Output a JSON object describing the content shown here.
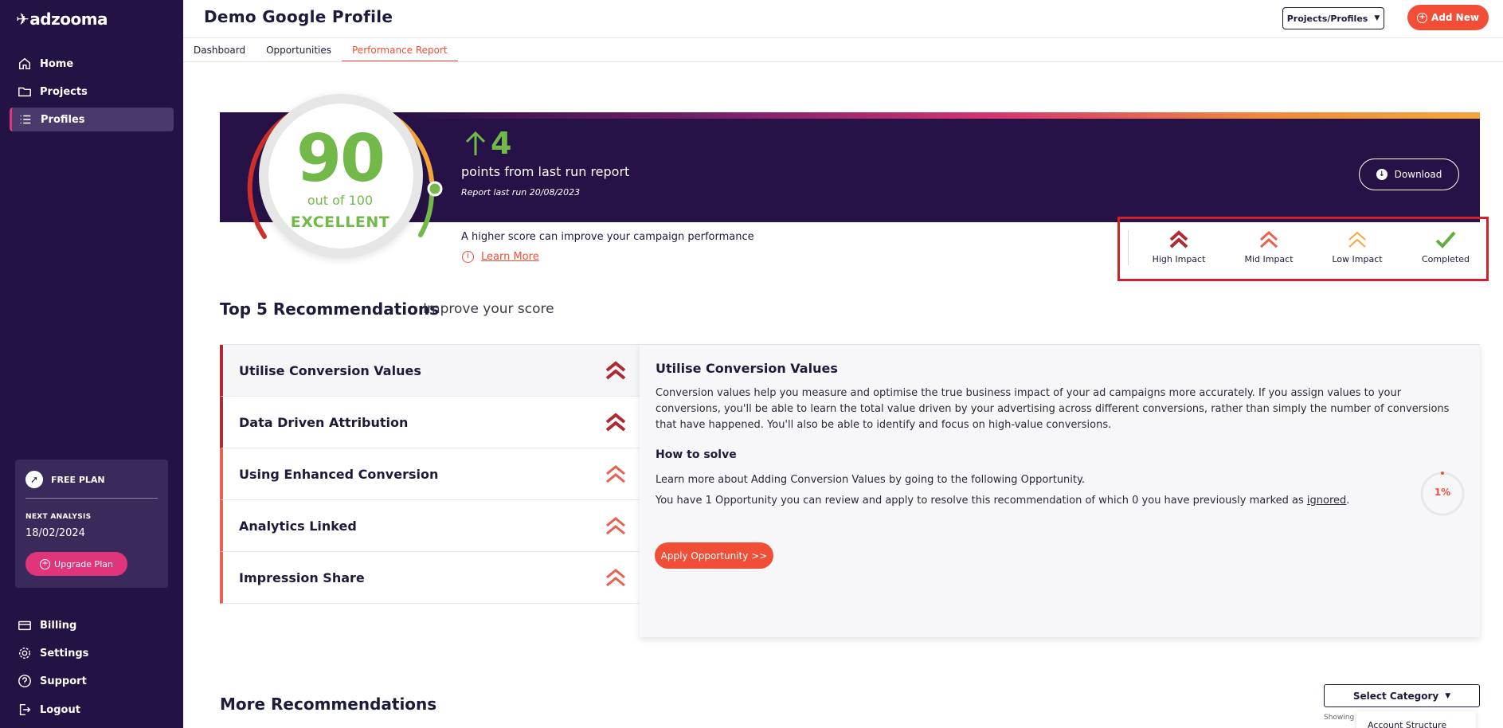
{
  "app": {
    "logo": "adzooma"
  },
  "sidebar": {
    "items": [
      {
        "label": "Home",
        "icon": "home-icon"
      },
      {
        "label": "Projects",
        "icon": "folder-icon"
      },
      {
        "label": "Profiles",
        "icon": "list-icon",
        "active": true
      }
    ],
    "plan": {
      "name": "FREE PLAN",
      "next_label": "NEXT ANALYSIS",
      "next_date": "18/02/2024",
      "upgrade_label": "Upgrade Plan"
    },
    "bottom_items": [
      {
        "label": "Billing",
        "icon": "card-icon"
      },
      {
        "label": "Settings",
        "icon": "gear-icon"
      },
      {
        "label": "Support",
        "icon": "help-icon"
      },
      {
        "label": "Logout",
        "icon": "logout-icon"
      }
    ]
  },
  "header": {
    "title": "Demo Google Profile",
    "projects_button": "Projects/Profiles",
    "add_new_button": "Add New"
  },
  "tabs": [
    {
      "label": "Dashboard"
    },
    {
      "label": "Opportunities"
    },
    {
      "label": "Performance Report",
      "active": true
    }
  ],
  "score": {
    "value": "90",
    "out_of": "out of 100",
    "rating": "EXCELLENT",
    "delta": "4",
    "delta_text": "points from last run report",
    "last_run": "Report last run 20/08/2023",
    "download_label": "Download",
    "hint": "A higher score can improve your campaign performance",
    "learn_more": "Learn More",
    "fraction": 0.9
  },
  "legend": {
    "items": [
      {
        "label": "High Impact",
        "color": "#b02a33"
      },
      {
        "label": "Mid Impact",
        "color": "#e8614f"
      },
      {
        "label": "Low Impact",
        "color": "#f5a63b"
      },
      {
        "label": "Completed",
        "color": "#5fae3e"
      }
    ]
  },
  "top5": {
    "title": "Top 5 Recommendations",
    "subtitle": "Improve your score",
    "items": [
      {
        "label": "Utilise Conversion Values",
        "impact": "high"
      },
      {
        "label": "Data Driven Attribution",
        "impact": "high"
      },
      {
        "label": "Using Enhanced Conversion",
        "impact": "mid"
      },
      {
        "label": "Analytics Linked",
        "impact": "mid"
      },
      {
        "label": "Impression Share",
        "impact": "mid"
      }
    ],
    "detail": {
      "title": "Utilise Conversion Values",
      "description": "Conversion values help you measure and optimise the true business impact of your ad campaigns more accurately. If you assign values to your conversions, you'll be able to learn the total value driven by your advertising across different conversions, rather than simply the number of conversions that have happened. You'll also be able to identify and focus on high-value conversions.",
      "how_to_title": "How to solve",
      "how_to_line1": "Learn more about Adding Conversion Values by going to the following Opportunity.",
      "how_to_line2": "You have 1 Opportunity you can review and apply to resolve this recommendation of which 0 you have previously marked as ",
      "ignored_link": "ignored",
      "how_to_line2_end": ".",
      "progress": "1%",
      "apply_label": "Apply Opportunity >>"
    }
  },
  "more": {
    "title": "More Recommendations",
    "select_label": "Select Category",
    "showing": "Showing",
    "dropdown_first": "Account Structure"
  }
}
